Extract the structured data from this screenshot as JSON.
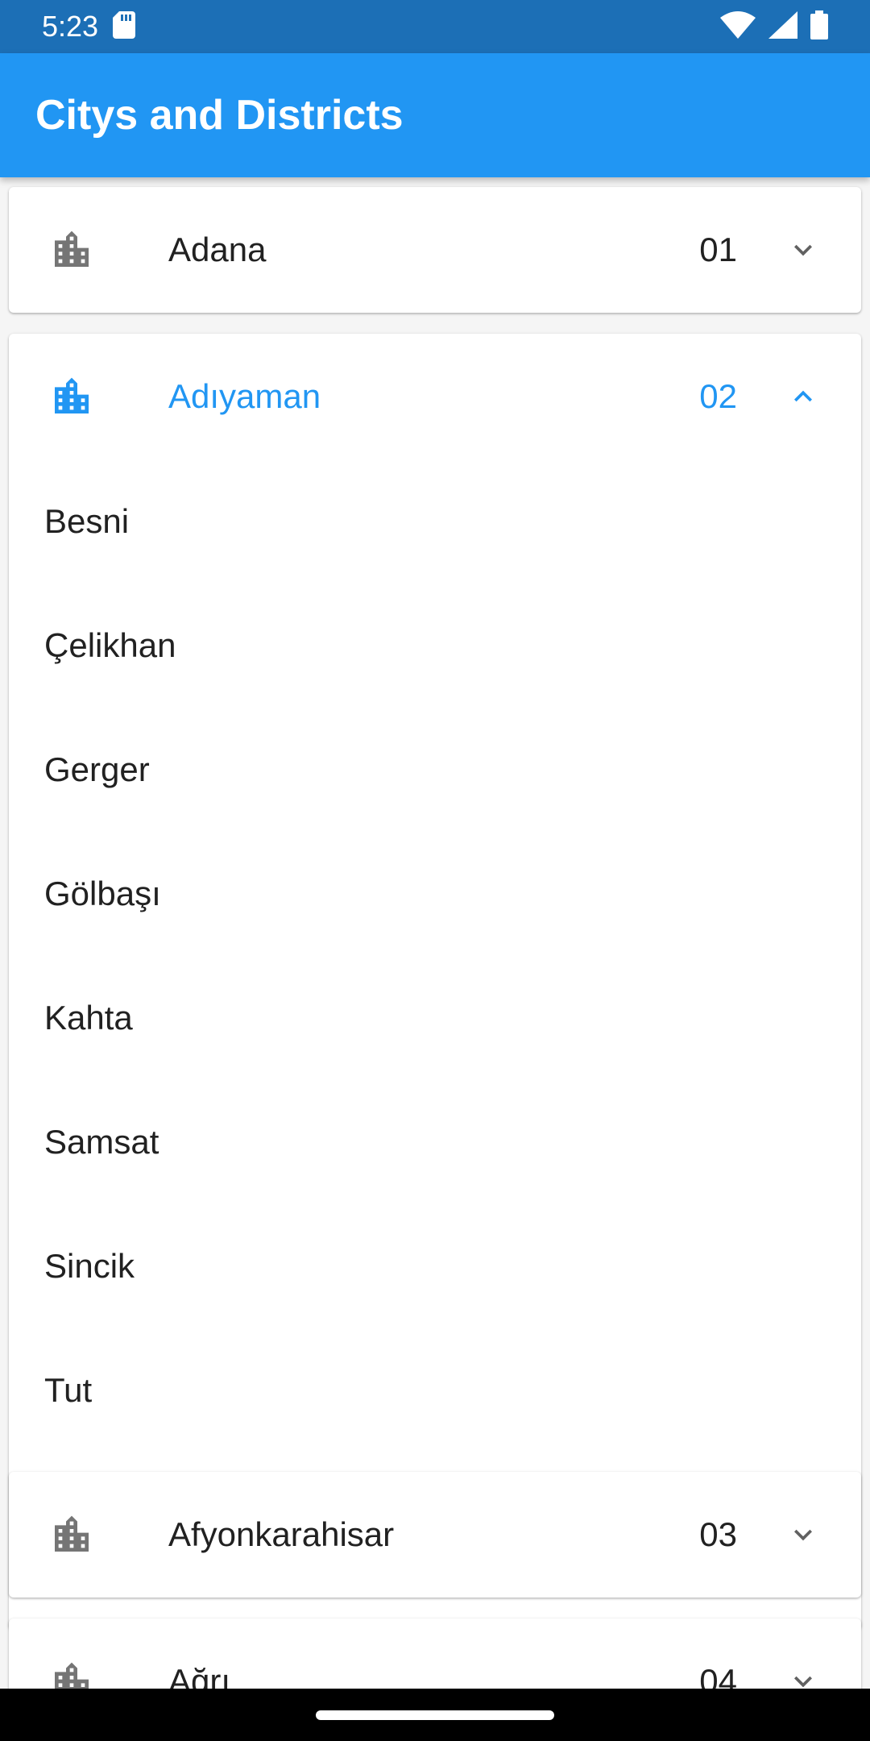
{
  "status_bar": {
    "time": "5:23",
    "icons": [
      "sd-card-icon",
      "wifi-icon",
      "signal-icon",
      "battery-icon"
    ]
  },
  "app_bar": {
    "title": "Citys and Districts",
    "color": "#2196f3"
  },
  "cities": [
    {
      "name": "Adana",
      "code": "01",
      "expanded": false
    },
    {
      "name": "Adıyaman",
      "code": "02",
      "expanded": true,
      "districts": [
        "Besni",
        "Çelikhan",
        "Gerger",
        "Gölbaşı",
        "Kahta",
        "Samsat",
        "Sincik",
        "Tut"
      ]
    },
    {
      "name": "Afyonkarahisar",
      "code": "03",
      "expanded": false
    },
    {
      "name": "Ağrı",
      "code": "04",
      "expanded": false
    }
  ],
  "colors": {
    "accent": "#2196f3",
    "status_bar": "#1c6fb6",
    "icon_gray": "#757575",
    "text": "#212121"
  }
}
